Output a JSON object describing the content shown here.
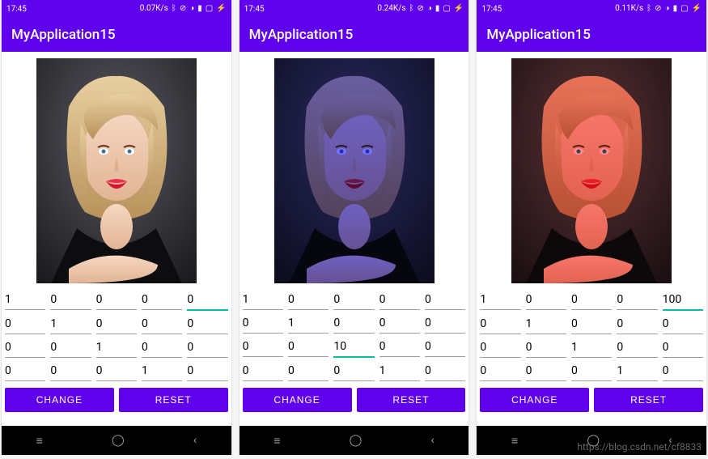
{
  "watermark": "https://blog.csdn.net/cf8833",
  "screens": [
    {
      "status": {
        "time": "17:45",
        "net": "0.07K/s"
      },
      "icons": [
        "bluetooth-icon",
        "dnd-icon",
        "wifi-icon",
        "signal-icon",
        "battery-icon",
        "charge-icon"
      ],
      "title": "MyApplication15",
      "tint": "none",
      "matrix": [
        [
          "1",
          "0",
          "0",
          "0",
          "0"
        ],
        [
          "0",
          "1",
          "0",
          "0",
          "0"
        ],
        [
          "0",
          "0",
          "1",
          "0",
          "0"
        ],
        [
          "0",
          "0",
          "0",
          "1",
          "0"
        ]
      ],
      "focused": [
        0,
        4
      ],
      "buttons": {
        "change": "CHANGE",
        "reset": "RESET"
      },
      "nav": [
        "menu-icon",
        "circle-icon",
        "back-icon"
      ]
    },
    {
      "status": {
        "time": "17:45",
        "net": "0.24K/s"
      },
      "icons": [
        "bluetooth-icon",
        "dnd-icon",
        "wifi-icon",
        "signal-icon",
        "battery-icon",
        "charge-icon"
      ],
      "title": "MyApplication15",
      "tint": "blue",
      "matrix": [
        [
          "1",
          "0",
          "0",
          "0",
          "0"
        ],
        [
          "0",
          "1",
          "0",
          "0",
          "0"
        ],
        [
          "0",
          "0",
          "10",
          "0",
          "0"
        ],
        [
          "0",
          "0",
          "0",
          "1",
          "0"
        ]
      ],
      "focused": [
        2,
        2
      ],
      "buttons": {
        "change": "CHANGE",
        "reset": "RESET"
      },
      "nav": [
        "menu-icon",
        "circle-icon",
        "back-icon"
      ]
    },
    {
      "status": {
        "time": "17:45",
        "net": "0.11K/s"
      },
      "icons": [
        "bluetooth-icon",
        "dnd-icon",
        "wifi-icon",
        "signal-icon",
        "battery-icon",
        "charge-icon"
      ],
      "title": "MyApplication15",
      "tint": "red",
      "matrix": [
        [
          "1",
          "0",
          "0",
          "0",
          "100"
        ],
        [
          "0",
          "1",
          "0",
          "0",
          "0"
        ],
        [
          "0",
          "0",
          "1",
          "0",
          "0"
        ],
        [
          "0",
          "0",
          "0",
          "1",
          "0"
        ]
      ],
      "focused": [
        0,
        4
      ],
      "buttons": {
        "change": "CHANGE",
        "reset": "RESET"
      },
      "nav": [
        "menu-icon",
        "circle-icon",
        "back-icon"
      ]
    }
  ]
}
